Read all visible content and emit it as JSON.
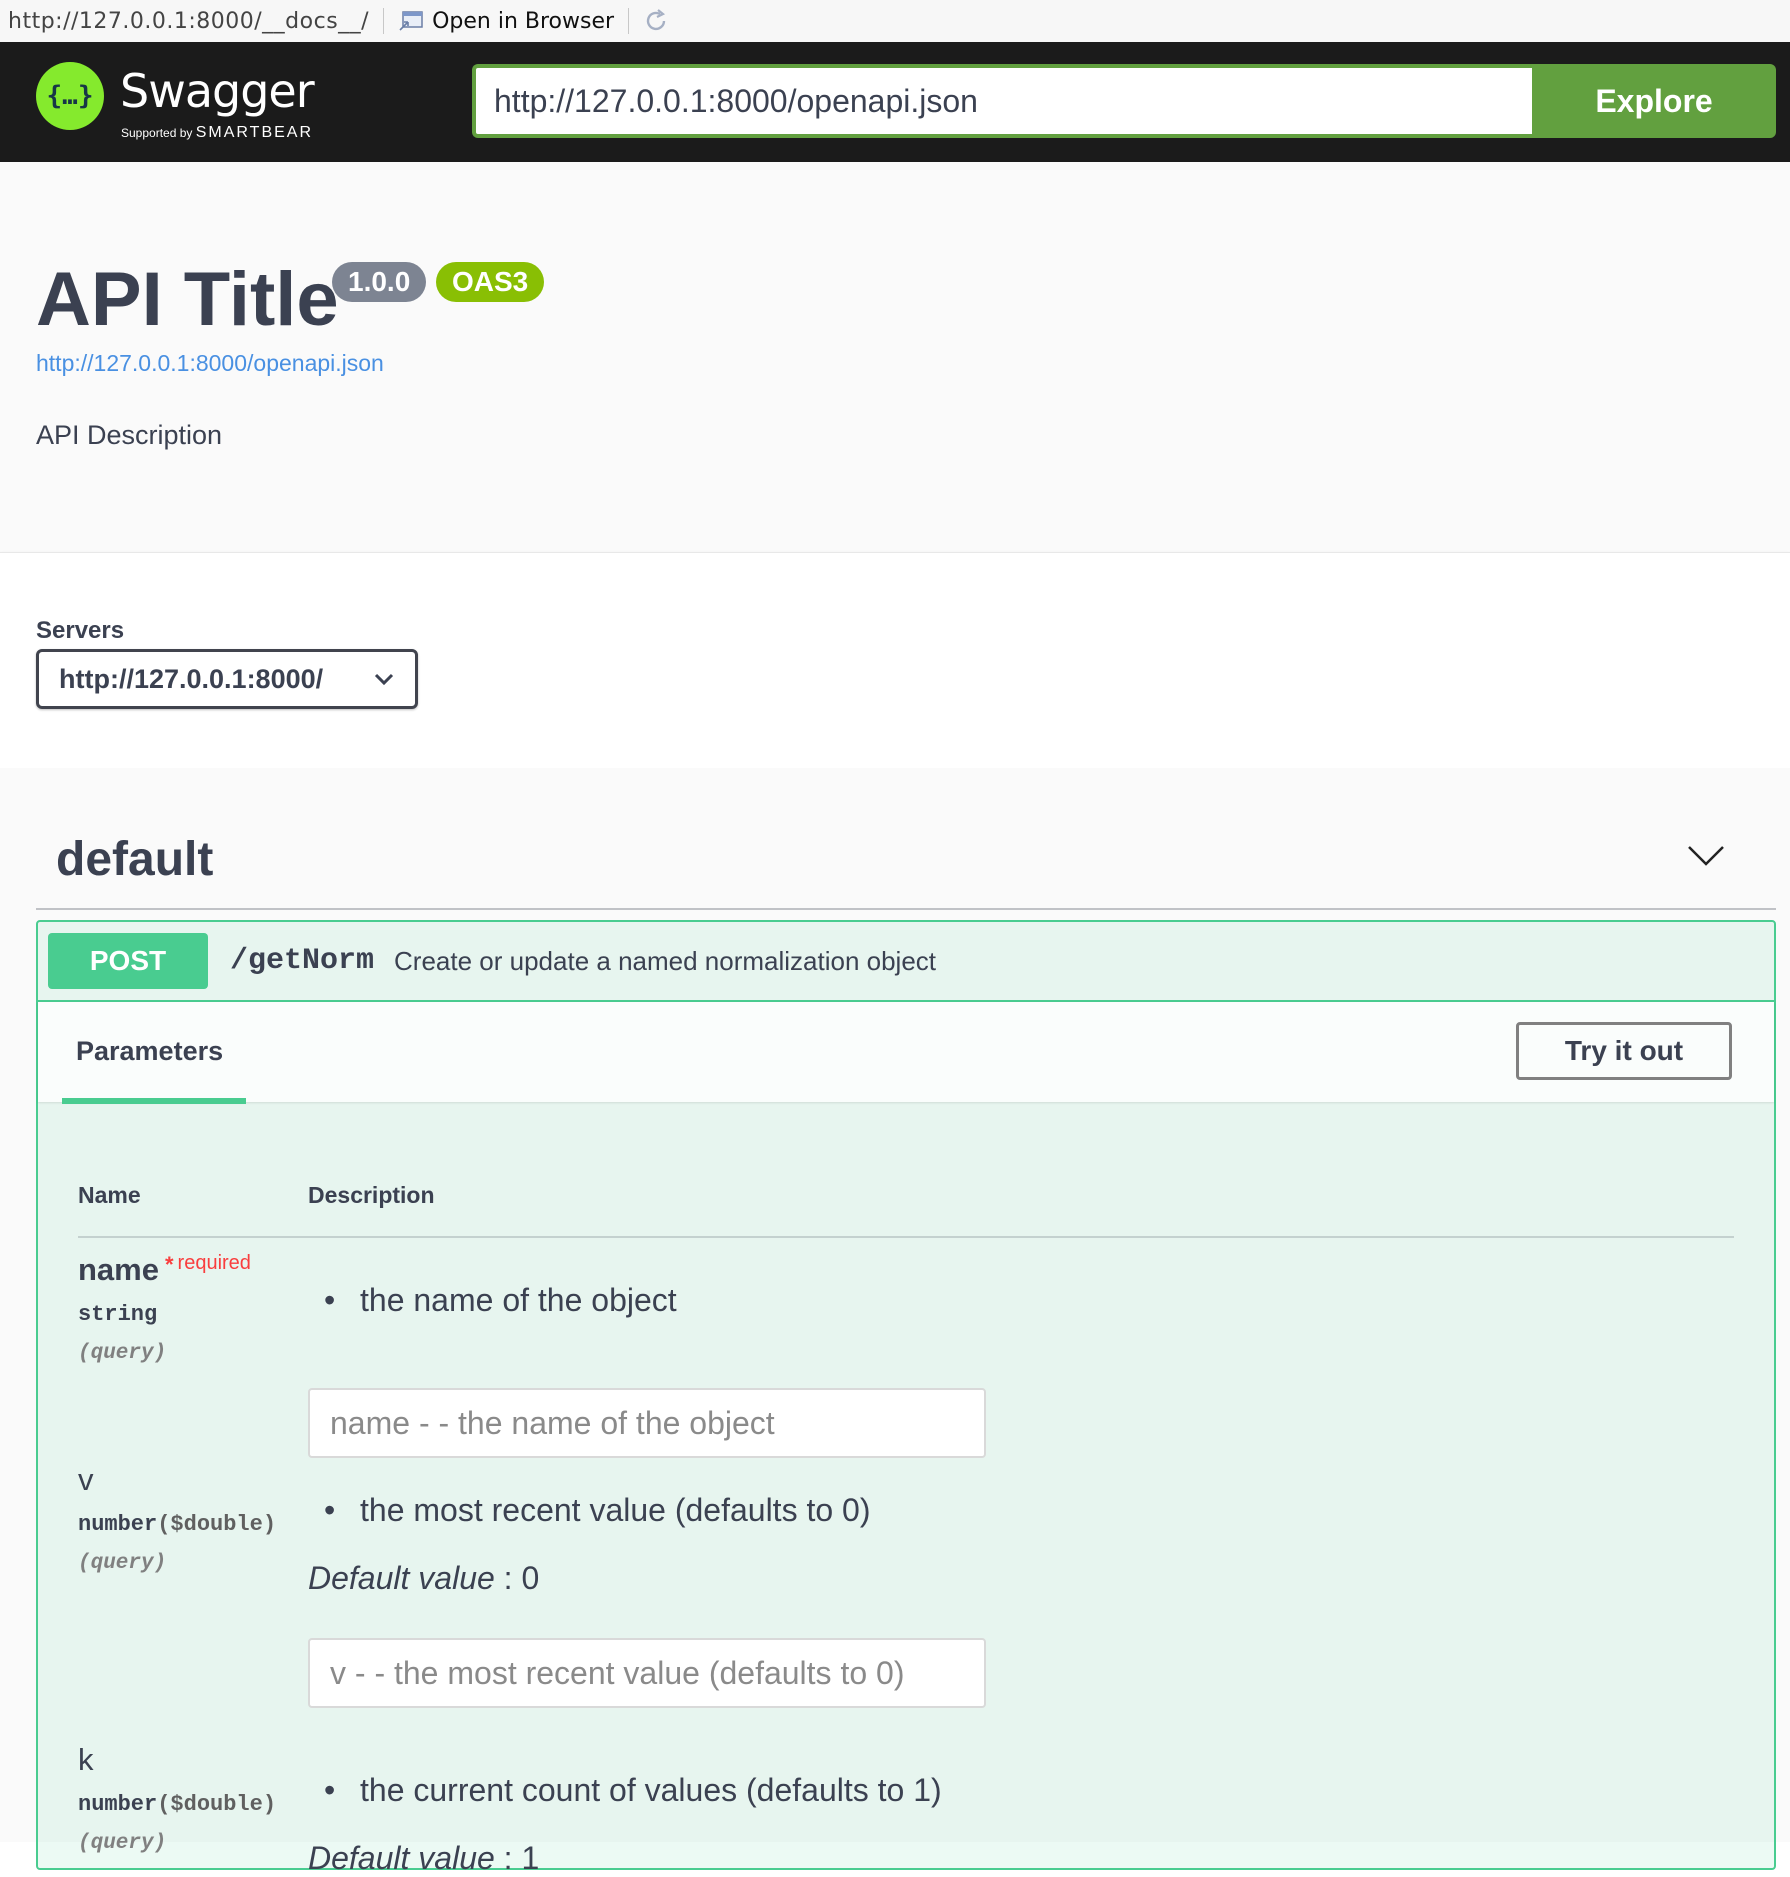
{
  "browser_bar": {
    "url": "http://127.0.0.1:8000/__docs__/",
    "open_label": "Open in Browser"
  },
  "topbar": {
    "logo_name": "Swagger",
    "logo_support_prefix": "Supported by",
    "logo_support_brand": "SMARTBEAR",
    "spec_url": "http://127.0.0.1:8000/openapi.json",
    "explore_label": "Explore"
  },
  "info": {
    "title": "API Title",
    "version": "1.0.0",
    "oas_badge": "OAS3",
    "spec_link": "http://127.0.0.1:8000/openapi.json",
    "description": "API Description"
  },
  "servers": {
    "label": "Servers",
    "selected": "http://127.0.0.1:8000/"
  },
  "tag": {
    "name": "default"
  },
  "operation": {
    "method": "POST",
    "path": "/getNorm",
    "summary": "Create or update a named normalization object",
    "params_tab": "Parameters",
    "try_label": "Try it out",
    "col_name": "Name",
    "col_description": "Description",
    "params": [
      {
        "name": "name",
        "required_star": "*",
        "required_text": "required",
        "type": "string",
        "format": "",
        "in": "(query)",
        "description": "the name of the object",
        "default_label": "",
        "default_value": "",
        "placeholder": "name - - the name of the object"
      },
      {
        "name": "v",
        "type": "number",
        "format": "($double)",
        "in": "(query)",
        "description": "the most recent value (defaults to 0)",
        "default_label": "Default value",
        "default_value": " : 0",
        "placeholder": "v - - the most recent value (defaults to 0)"
      },
      {
        "name": "k",
        "type": "number",
        "format": "($double)",
        "in": "(query)",
        "description": "the current count of values (defaults to 1)",
        "default_label": "Default value",
        "default_value": " : 1",
        "placeholder": ""
      }
    ]
  },
  "colors": {
    "topbar_bg": "#1b1b1b",
    "swagger_green": "#85ea2d",
    "explore_green": "#62a03f",
    "post_green": "#49cc90",
    "version_gray": "#7d8492",
    "oas_green": "#89bf04",
    "link_blue": "#4990e2",
    "required_red": "#f93e3e"
  },
  "icons": {
    "logo": "swagger-braces-icon",
    "open_browser": "browser-window-icon",
    "reload": "reload-icon",
    "server_dropdown": "chevron-down-icon",
    "tag_toggle": "chevron-down-icon"
  }
}
